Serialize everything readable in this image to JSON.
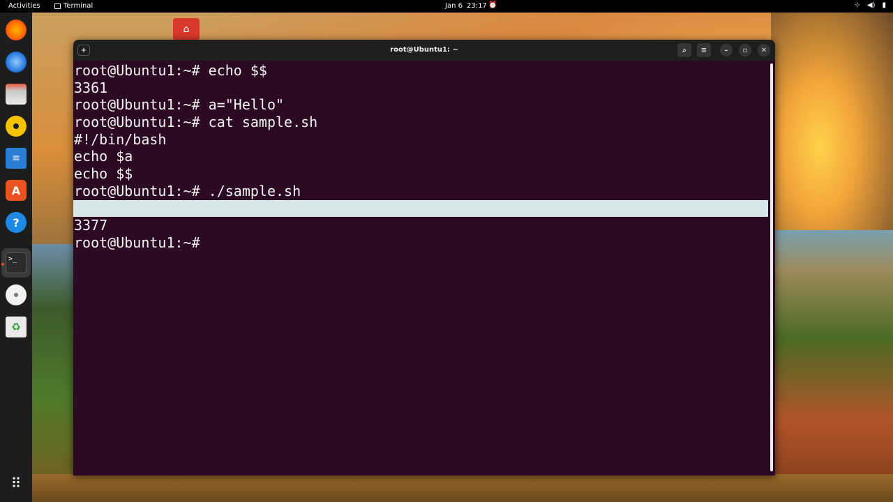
{
  "topbar": {
    "activities": "Activities",
    "app_name": "Terminal",
    "date": "Jan 6",
    "time": "23:17",
    "icons": [
      "network-icon",
      "volume-icon",
      "battery-icon",
      "notification-icon"
    ]
  },
  "dock": {
    "items": [
      {
        "name": "firefox",
        "icon": "firefox-icon"
      },
      {
        "name": "thunderbird",
        "icon": "thunderbird-icon"
      },
      {
        "name": "files",
        "icon": "files-icon"
      },
      {
        "name": "rhythmbox",
        "icon": "rhythmbox-icon"
      },
      {
        "name": "libreoffice-writer",
        "icon": "writer-icon"
      },
      {
        "name": "ubuntu-software",
        "icon": "software-icon"
      },
      {
        "name": "help",
        "icon": "help-icon"
      },
      {
        "name": "terminal",
        "icon": "terminal-icon",
        "active": true
      },
      {
        "name": "dvd",
        "icon": "disc-icon"
      },
      {
        "name": "trash",
        "icon": "trash-icon"
      },
      {
        "name": "show-apps",
        "icon": "grid-icon"
      }
    ],
    "accent": "#e95420"
  },
  "window": {
    "title": "root@Ubuntu1: ~"
  },
  "terminal": {
    "lines": [
      "root@Ubuntu1:~# echo $$",
      "3361",
      "root@Ubuntu1:~# a=\"Hello\"",
      "root@Ubuntu1:~# cat sample.sh",
      "#!/bin/bash",
      "echo $a",
      "echo $$",
      "root@Ubuntu1:~# ./sample.sh",
      "",
      "3377",
      "root@Ubuntu1:~# "
    ],
    "highlighted_line_index": 8,
    "background": "#2c0a24",
    "foreground": "#f2f2f2",
    "highlight_color": "#d6e6ea"
  }
}
